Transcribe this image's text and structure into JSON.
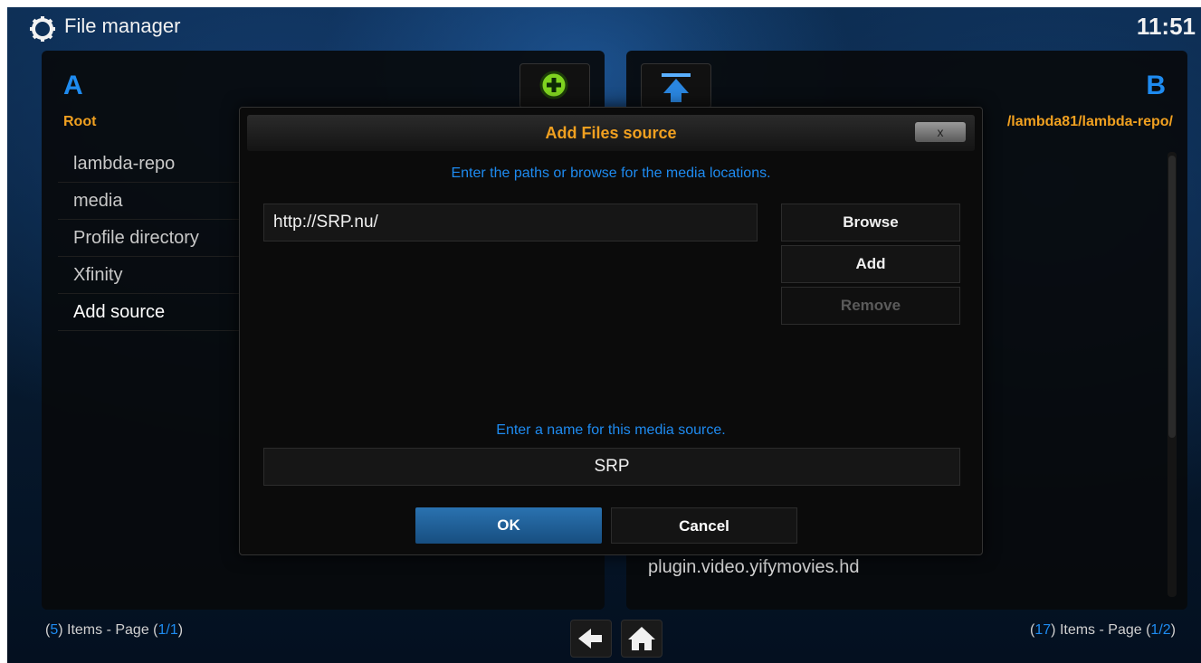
{
  "header": {
    "title": "File manager",
    "clock": "11:51",
    "icon": "gear-icon"
  },
  "left_pane": {
    "letter": "A",
    "path": "Root",
    "items": [
      "lambda-repo",
      "media",
      "Profile directory",
      "Xfinity",
      "Add source"
    ],
    "footer": {
      "count": "5",
      "page": "1/1",
      "label_items": "Items - Page"
    }
  },
  "right_pane": {
    "letter": "B",
    "path": "/lambda81/lambda-repo/",
    "visible_item": "plugin.video.yifymovies.hd",
    "footer": {
      "count": "17",
      "page": "1/2",
      "label_items": "Items - Page"
    }
  },
  "toolbar": {
    "add_icon": "plus-circle-icon",
    "up_icon": "up-arrow-icon"
  },
  "nav": {
    "back_icon": "back-arrow-icon",
    "home_icon": "home-icon"
  },
  "dialog": {
    "title": "Add Files source",
    "close_label": "x",
    "paths_prompt": "Enter the paths or browse for the media locations.",
    "path_value": "http://SRP.nu/",
    "browse_label": "Browse",
    "add_label": "Add",
    "remove_label": "Remove",
    "name_prompt": "Enter a name for this media source.",
    "name_value": "SRP",
    "ok_label": "OK",
    "cancel_label": "Cancel"
  },
  "colors": {
    "accent_blue": "#1e8bf0",
    "title_orange": "#f0a020",
    "ok_blue": "#2a72b0"
  }
}
